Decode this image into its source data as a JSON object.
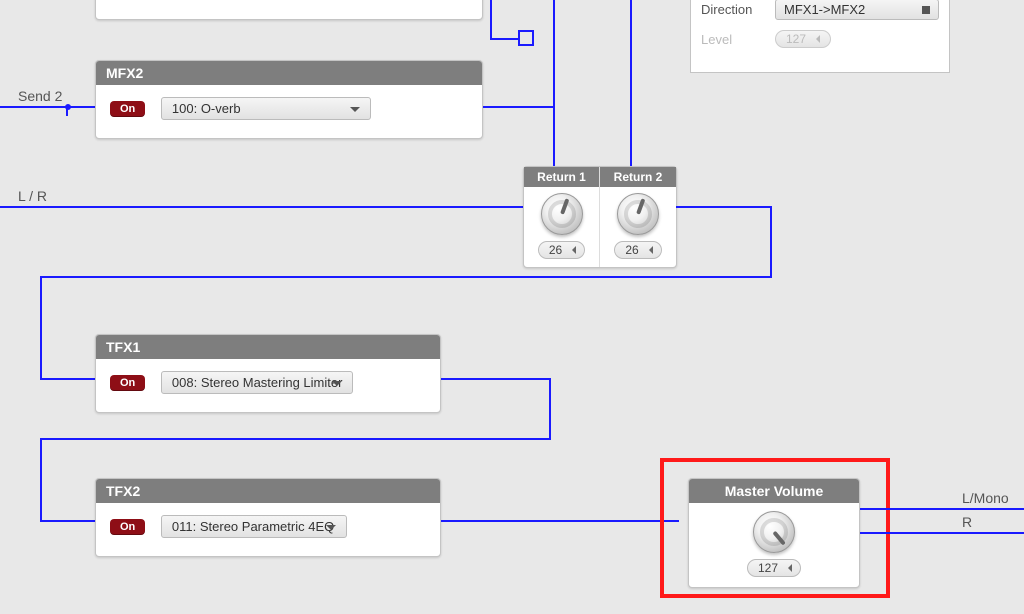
{
  "labels": {
    "send2": "Send 2",
    "lr": "L / R",
    "outLMono": "L/Mono",
    "outR": "R"
  },
  "routing": {
    "directionLabel": "Direction",
    "directionValue": "MFX1->MFX2",
    "levelLabel": "Level",
    "levelValue": "127"
  },
  "mfx2": {
    "title": "MFX2",
    "on": "On",
    "preset": "100: O-verb"
  },
  "tfx1": {
    "title": "TFX1",
    "on": "On",
    "preset": "008: Stereo Mastering Limiter"
  },
  "tfx2": {
    "title": "TFX2",
    "on": "On",
    "preset": "011: Stereo Parametric 4EQ"
  },
  "returns": {
    "r1Label": "Return 1",
    "r2Label": "Return 2",
    "r1Value": "26",
    "r2Value": "26"
  },
  "master": {
    "title": "Master Volume",
    "value": "127"
  }
}
